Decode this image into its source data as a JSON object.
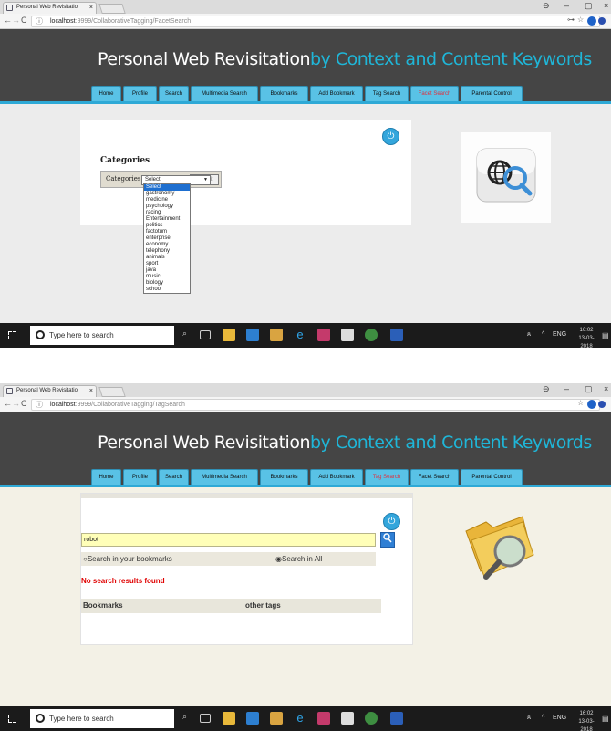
{
  "browser": {
    "tab_title": "Personal Web Revisitatio",
    "tab_close": "×",
    "account_icon": "⊖",
    "minimize": "–",
    "maximize": "▢",
    "close": "×",
    "back": "←",
    "forward": "→",
    "reload": "C",
    "info_icon": "ⓘ",
    "key_icon": "⊶",
    "star_icon": "☆"
  },
  "site": {
    "title_main": "Personal Web Revisitation",
    "title_accent": "by Context and Content Keywords",
    "menu": [
      "Home",
      "Profile",
      "Search",
      "Multimedia Search",
      "Bookmarks",
      "Add Bookmark",
      "Tag Search",
      "Facet Search",
      "Parental Control"
    ],
    "logout_icon": "⏻"
  },
  "facet_page": {
    "url_host": "localhost",
    "url_path": ":9999/CollaborativeTagging/FacetSearch",
    "active_menu": "Facet Search",
    "heading": "Categories",
    "label": "Categories :",
    "select_value": "Select",
    "select_arrow": "▼",
    "submit": "Submit",
    "options": [
      "Select",
      "gastronomy",
      "medicine",
      "psychology",
      "racing",
      "Entertainment",
      "politics",
      "factotum",
      "enterprise",
      "economy",
      "telephony",
      "animals",
      "sport",
      "java",
      "music",
      "biology",
      "school"
    ],
    "highlighted_index": 0
  },
  "tag_page": {
    "url_host": "localhost",
    "url_path": ":9999/CollaborativeTagging/TagSearch",
    "active_menu": "Tag Search",
    "search_value": "robot",
    "scope_bookmarks": "Search in your bookmarks",
    "scope_all": "Search in All",
    "scope_selected": "all",
    "no_results": "No search results found",
    "col_bookmarks": "Bookmarks",
    "col_other_tags": "other tags"
  },
  "taskbar": {
    "search_placeholder": "Type here to search",
    "mic_icon": "⌕",
    "people_icon": "ጰ",
    "chevron_up": "^",
    "language": "ENG",
    "time": "16:02",
    "date": "13-03-2018",
    "notification_icon": "▤"
  },
  "colors": {
    "banner": "#454545",
    "accent": "#1fb6d8",
    "menu_tab": "#59c2e6",
    "active_menu_text": "#e0313f",
    "error_text": "#e00000",
    "search_field": "#ffffb8"
  }
}
